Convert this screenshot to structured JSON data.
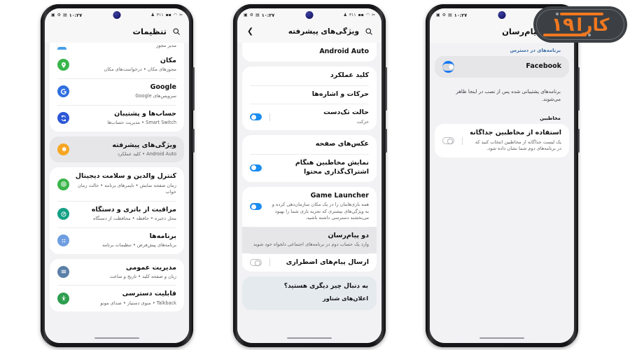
{
  "statusbar": {
    "time": "۱۰:۲۷",
    "left_icons": [
      "person-icon",
      "311-label",
      "signal-icon",
      "wifi-icon",
      "mute-icon"
    ],
    "right_icons": [
      "sim-icon",
      "bluetooth-icon",
      "battery-icon"
    ],
    "label_311": "۳۱۱"
  },
  "phone1": {
    "appbar": {
      "title": "تنظیمات",
      "search_icon": "search-icon"
    },
    "clipped_row": {
      "sub": "مدیر مجوز"
    },
    "groups": [
      {
        "items": [
          {
            "title": "مکان",
            "sub": "مجوزهای مکان  •  درخواست‌های مکان",
            "icon": "location-icon",
            "color": "#39b54a",
            "highlight": false
          },
          {
            "title": "Google",
            "sub": "سرویس‌های Google",
            "icon": "google-icon",
            "color": "#2f6fe0",
            "highlight": false,
            "ltr": true
          },
          {
            "title": "حساب‌ها و پشتیبان",
            "sub": "Smart Switch  •  مدیریت حساب‌ها",
            "icon": "accounts-sync-icon",
            "color": "#2c57d6",
            "highlight": false
          }
        ]
      },
      {
        "highlight": true,
        "items": [
          {
            "title": "ویژگی‌های پیشرفته",
            "sub": "Android Auto  •  کلید عملکرد",
            "icon": "gear-icon",
            "color": "#f5a623",
            "highlight": true
          }
        ]
      },
      {
        "items": [
          {
            "title": "کنترل والدین و سلامت دیجیتال",
            "sub": "زمان صفحه نمایش  •  تایمرهای برنامه  •  حالت زمان خواب",
            "icon": "digital-wellbeing-icon",
            "color": "#3ab54a",
            "highlight": false
          },
          {
            "title": "مراقبت از باتری و دستگاه",
            "sub": "محل ذخیره  •  حافظه  •  محافظت از دستگاه",
            "icon": "device-care-icon",
            "color": "#13a085",
            "highlight": false
          },
          {
            "title": "برنامه‌ها",
            "sub": "برنامه‌های پیش‌فرض  •  تنظیمات برنامه",
            "icon": "apps-grid-icon",
            "color": "#6e9ee0",
            "highlight": false
          }
        ]
      },
      {
        "items": [
          {
            "title": "مدیریت عمومی",
            "sub": "زبان و صفحه کلید  •  تاریخ و ساعت",
            "icon": "general-management-icon",
            "color": "#5a7fa8",
            "highlight": false
          },
          {
            "title": "قابلیت دسترسی",
            "sub": "Talkback  •  منوی دستیار  •  صدای مونو",
            "icon": "accessibility-icon",
            "color": "#2e9e4f",
            "highlight": false
          }
        ]
      }
    ]
  },
  "phone2": {
    "appbar": {
      "title": "ویژگی‌های پیشرفته",
      "search_icon": "search-icon",
      "back_icon": "chevron-back-icon"
    },
    "groups": [
      {
        "clip_top": true,
        "items": [
          {
            "title": "Android Auto",
            "sub": "",
            "ltr": true,
            "toggle": null
          }
        ]
      },
      {
        "items": [
          {
            "title": "کلید عملکرد",
            "sub": "",
            "toggle": null
          },
          {
            "title": "حرکات و اشاره‌ها",
            "sub": "",
            "toggle": null
          },
          {
            "title": "حالت تک‌دست",
            "sub": "حرکت",
            "toggle": "on"
          }
        ]
      },
      {
        "items": [
          {
            "title": "عکس‌های صفحه",
            "sub": "",
            "toggle": null
          },
          {
            "title": "نمایش مخاطبین هنگام اشتراک‌گذاری محتوا",
            "sub": "",
            "toggle": "on",
            "wrap": true
          }
        ]
      },
      {
        "items": [
          {
            "title": "Game Launcher",
            "sub": "همه بازی‌هایتان را در یک مکان سازمان‌دهی کرده و به ویژگی‌های بیشتری که تجربه بازی شما را بهبود می‌بخشند دسترسی داشته باشید.",
            "toggle": "on",
            "wrap": true,
            "ltr": true
          },
          {
            "title": "دو پیام‌رسان",
            "sub": "وارد یک حساب دوم در برنامه‌های اجتماعی دلخواه خود شوید",
            "toggle": null,
            "highlight": true,
            "wrap": true
          },
          {
            "title": "ارسال پیام‌های اضطراری",
            "sub": "",
            "toggle": "off"
          }
        ]
      }
    ],
    "tip": {
      "title": "به دنبال چیز دیگری هستید؟",
      "item": "اعلان‌های شناور"
    }
  },
  "phone3": {
    "appbar": {
      "title": "دو پیام‌رسان",
      "menu_icon": "kebab-menu-icon"
    },
    "section1_label": "برنامه‌های در دسترس",
    "facebook": {
      "label": "Facebook",
      "icon": "facebook-icon",
      "toggle": "offgray"
    },
    "note": "برنامه‌های پشتیبانی شده پس از نصب در اینجا ظاهر می‌شوند.",
    "section2_label": "مخاطبین",
    "contacts": {
      "title": "استفاده از مخاطبین جداگانه",
      "sub": "یک لیست جداگانه از مخاطبین انتخاب کنید که در برنامه‌های دوم شما نشان داده شود.",
      "toggle": "off"
    }
  },
  "watermark": {
    "kara": "کارا",
    "num": "۱۹"
  }
}
